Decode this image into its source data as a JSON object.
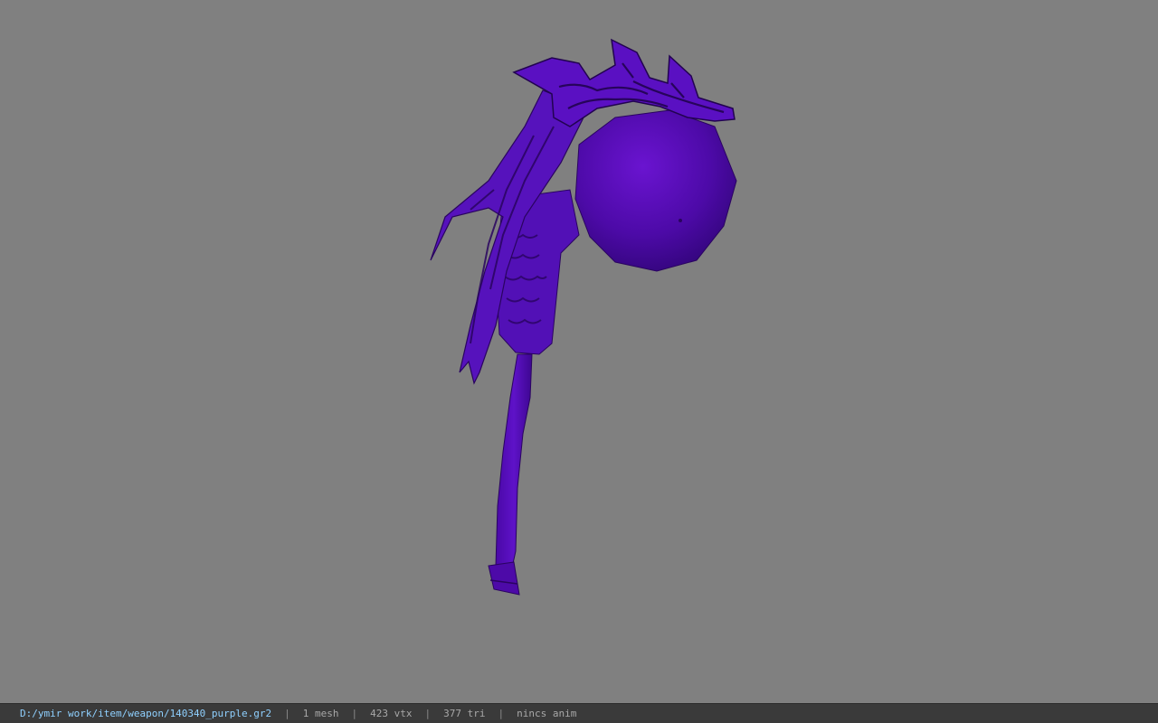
{
  "viewer": {
    "background_color": "#808080",
    "model": {
      "color": "#5a0fc0",
      "shade_color": "#3a0680",
      "highlight_color": "#7a22e0"
    }
  },
  "status_bar": {
    "path": "D:/ymir work/item/weapon/140340_purple.gr2",
    "separator": "|",
    "mesh": "1 mesh",
    "vtx": "423 vtx",
    "tri": "377 tri",
    "anim": "nincs anim",
    "path_color": "#8fd0ff"
  }
}
